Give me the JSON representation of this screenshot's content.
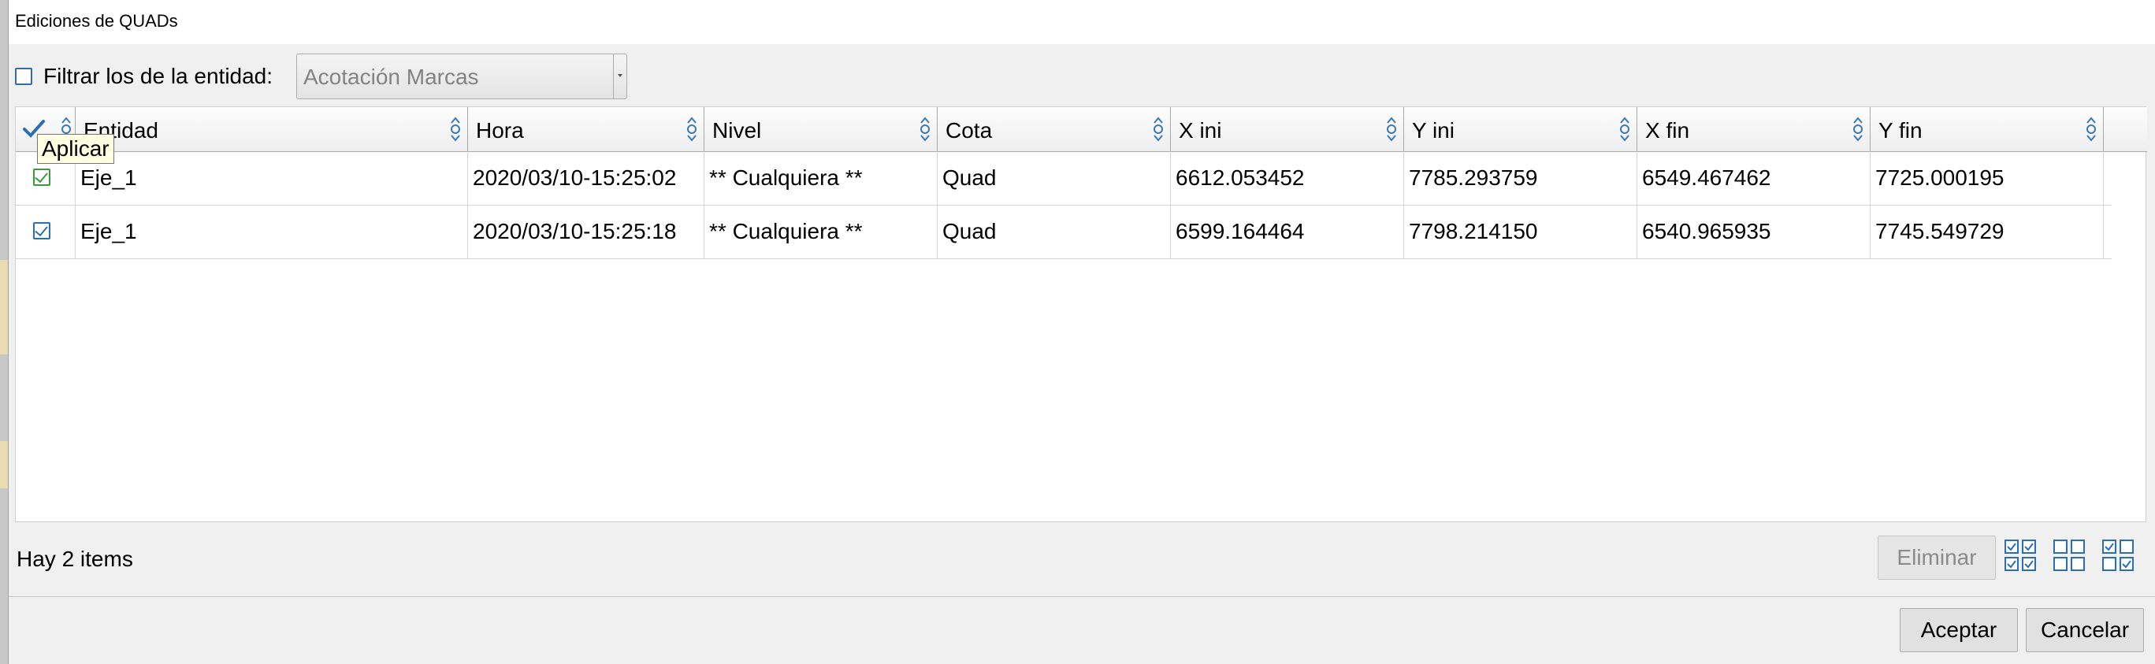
{
  "window": {
    "title": "Ediciones de QUADs"
  },
  "filter": {
    "checkbox_checked": false,
    "label": "Filtrar los de la entidad:",
    "combo_value": "Acotación Marcas"
  },
  "table": {
    "columns": [
      "Entidad",
      "Hora",
      "Nivel",
      "Cota",
      "X ini",
      "Y ini",
      "X fin",
      "Y fin"
    ],
    "rows": [
      {
        "checked": true,
        "entidad": "Eje_1",
        "hora": "2020/03/10-15:25:02",
        "nivel": "** Cualquiera **",
        "cota": "Quad",
        "x_ini": "6612.053452",
        "y_ini": "7785.293759",
        "x_fin": "6549.467462",
        "y_fin": "7725.000195"
      },
      {
        "checked": true,
        "entidad": "Eje_1",
        "hora": "2020/03/10-15:25:18",
        "nivel": "** Cualquiera **",
        "cota": "Quad",
        "x_ini": "6599.164464",
        "y_ini": "7798.214150",
        "x_fin": "6540.965935",
        "y_fin": "7745.549729"
      }
    ],
    "tooltip": "Aplicar"
  },
  "footer": {
    "count_text": "Hay 2 items",
    "delete_label": "Eliminar",
    "accept_label": "Aceptar",
    "cancel_label": "Cancelar"
  },
  "colors": {
    "accent_blue": "#2a6fb5",
    "check_green": "#3a9b3a",
    "tooltip_bg": "#ffffe1"
  }
}
